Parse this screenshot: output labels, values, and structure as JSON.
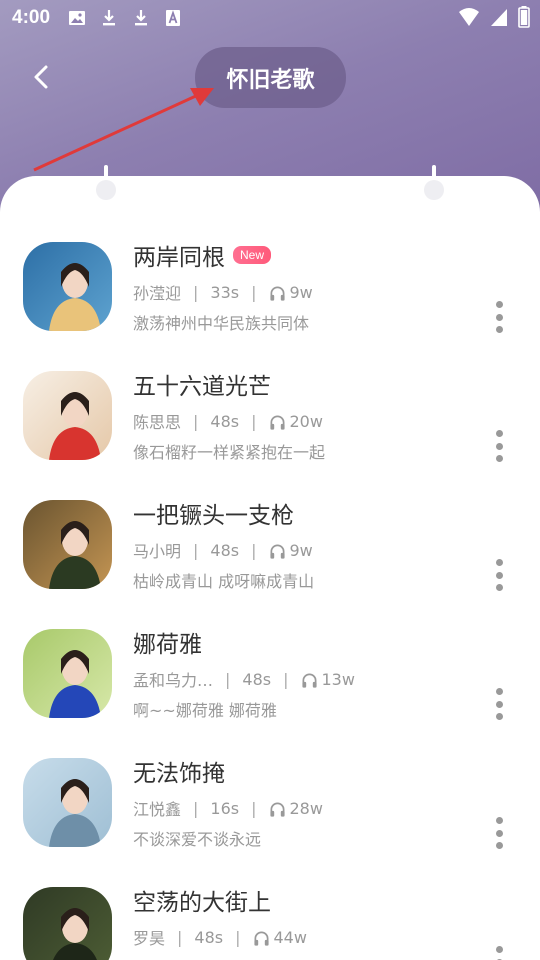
{
  "status_bar": {
    "time": "4:00"
  },
  "header": {
    "title": "怀旧老歌"
  },
  "songs": [
    {
      "title": "两岸同根",
      "badge": "New",
      "artist": "孙滢迎",
      "duration": "33s",
      "plays": "9w",
      "subtitle": "激荡神州中华民族共同体",
      "cover_colors": [
        "#2d6fa6",
        "#5ea3d0",
        "#e9c37a"
      ]
    },
    {
      "title": "五十六道光芒",
      "badge": "",
      "artist": "陈思思",
      "duration": "48s",
      "plays": "20w",
      "subtitle": "像石榴籽一样紧紧抱在一起",
      "cover_colors": [
        "#f7efe5",
        "#e5c8a8",
        "#d8342f"
      ]
    },
    {
      "title": "一把镢头一支枪",
      "badge": "",
      "artist": "马小明",
      "duration": "48s",
      "plays": "9w",
      "subtitle": "枯岭成青山 成呀嘛成青山",
      "cover_colors": [
        "#6a5430",
        "#c49553",
        "#2b3a22"
      ]
    },
    {
      "title": "娜荷雅",
      "badge": "",
      "artist": "孟和乌力…",
      "duration": "48s",
      "plays": "13w",
      "subtitle": "啊~~娜荷雅 娜荷雅",
      "cover_colors": [
        "#a8c96a",
        "#d7e8a9",
        "#2447b8"
      ]
    },
    {
      "title": "无法饰掩",
      "badge": "",
      "artist": "江悦鑫",
      "duration": "16s",
      "plays": "28w",
      "subtitle": "不谈深爱不谈永远",
      "cover_colors": [
        "#c7dcea",
        "#9fbfd4",
        "#6e8fa8"
      ]
    },
    {
      "title": "空荡的大街上",
      "badge": "",
      "artist": "罗昊",
      "duration": "48s",
      "plays": "44w",
      "subtitle": "",
      "cover_colors": [
        "#2f3a25",
        "#4e5e35",
        "#1e2618"
      ]
    }
  ],
  "colors": {
    "header_gradient_start": "#a39bc0",
    "header_gradient_end": "#7d6aa3",
    "arrow": "#e03a3a",
    "badge": "#ff5a7a",
    "text_primary": "#333333",
    "text_secondary": "#999999"
  }
}
